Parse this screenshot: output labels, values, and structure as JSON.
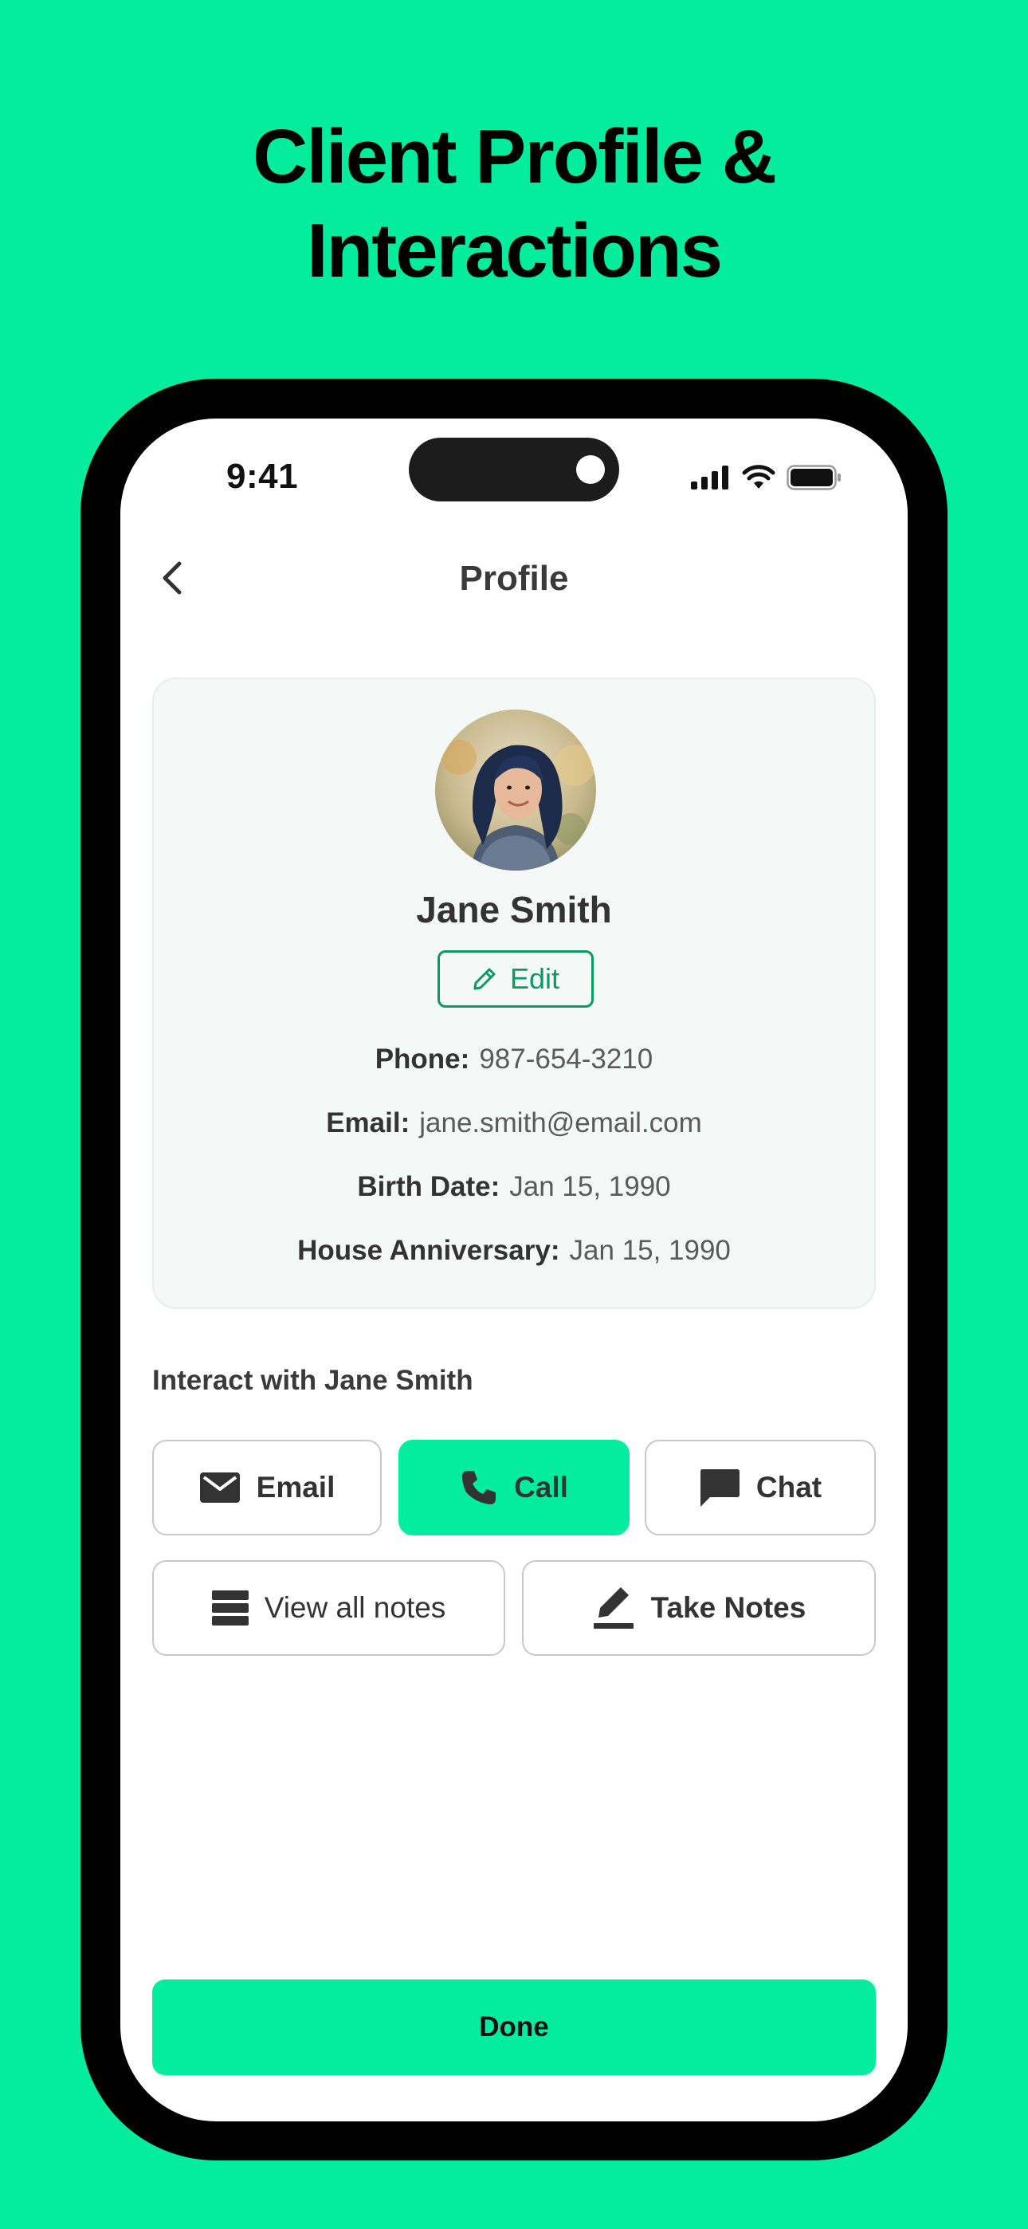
{
  "headline": {
    "line1": "Client Profile &",
    "line2": "Interactions"
  },
  "status_bar": {
    "time": "9:41"
  },
  "nav": {
    "title": "Profile"
  },
  "profile": {
    "name": "Jane Smith",
    "edit_label": "Edit",
    "fields": [
      {
        "label": "Phone:",
        "value": "987-654-3210"
      },
      {
        "label": "Email:",
        "value": "jane.smith@email.com"
      },
      {
        "label": "Birth Date:",
        "value": "Jan 15, 1990"
      },
      {
        "label": "House Anniversary:",
        "value": "Jan 15, 1990"
      }
    ]
  },
  "interact": {
    "title": "Interact with Jane Smith",
    "buttons": [
      {
        "label": "Email",
        "icon": "envelope-icon"
      },
      {
        "label": "Call",
        "icon": "phone-icon"
      },
      {
        "label": "Chat",
        "icon": "chat-bubble-icon"
      },
      {
        "label": "View all notes",
        "icon": "list-icon"
      },
      {
        "label": "Take Notes",
        "icon": "pencil-icon"
      }
    ]
  },
  "footer": {
    "done_label": "Done"
  },
  "colors": {
    "accent": "#04ED9E",
    "edit_green": "#0A9A66",
    "card_bg": "#F4F8F6",
    "frame": "#000000"
  }
}
